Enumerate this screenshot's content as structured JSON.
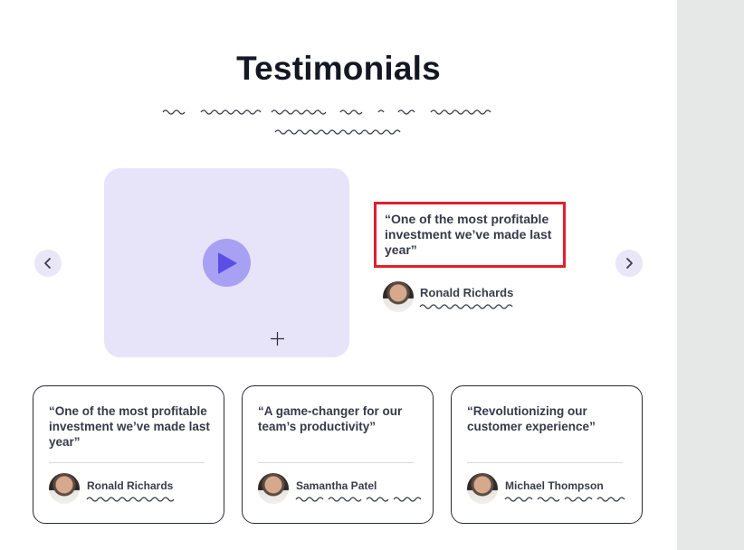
{
  "page": {
    "title": "Testimonials"
  },
  "carousel": {
    "prev_icon": "chevron-left-icon",
    "next_icon": "chevron-right-icon",
    "video": {
      "play_icon": "play-icon",
      "bg_color": "#e7e3f8",
      "accent_color": "#5a4ee6"
    },
    "featured": {
      "quote": "“One of the most profitable investment we’ve made last year”",
      "author": "Ronald Richards",
      "highlight_color": "#e0202c"
    }
  },
  "cards": [
    {
      "quote": "“One of the most profitable investment we’ve made last year”",
      "author": "Ronald Richards"
    },
    {
      "quote": "“A game-changer for our team’s productivity”",
      "author": "Samantha Patel"
    },
    {
      "quote": "“Revolutionizing our customer experience”",
      "author": "Michael Thompson"
    }
  ]
}
